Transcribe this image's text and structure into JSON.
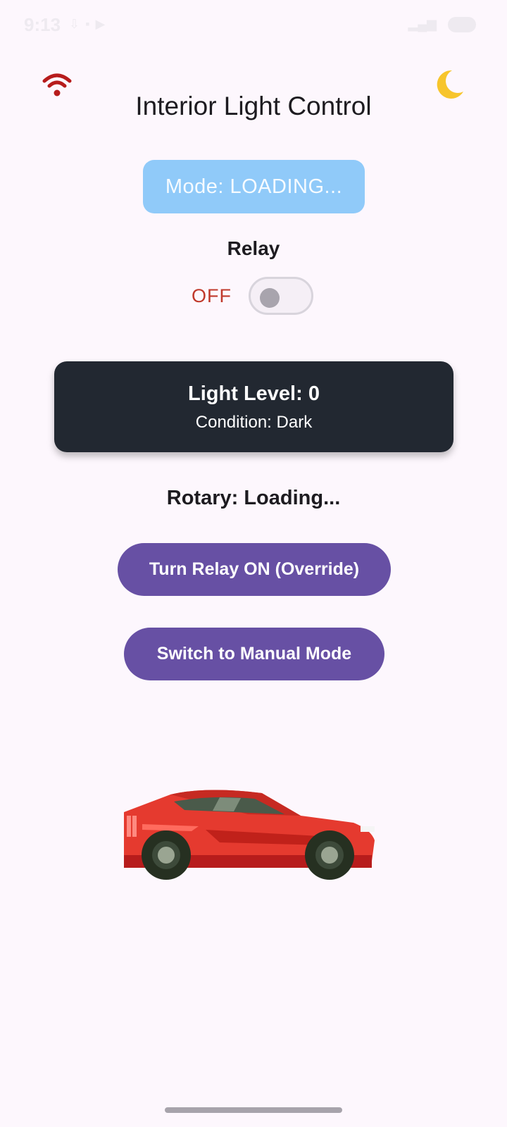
{
  "status_bar": {
    "time": "9:13",
    "battery": "■"
  },
  "header": {
    "title": "Interior Light Control",
    "wifi_icon": "wifi-icon",
    "theme_icon": "moon-icon"
  },
  "mode": {
    "label": "Mode: LOADING..."
  },
  "relay": {
    "label": "Relay",
    "state": "OFF",
    "switch_on": false
  },
  "light_card": {
    "level": "Light Level: 0",
    "condition": "Condition: Dark"
  },
  "rotary": {
    "label": "Rotary: Loading..."
  },
  "actions": {
    "relay_button": "Turn Relay ON (Override)",
    "mode_button": "Switch to Manual Mode"
  },
  "colors": {
    "background": "#fdf7fd",
    "mode_pill": "#90caf9",
    "relay_off": "#c0392b",
    "card": "#222831",
    "button": "#6750a4",
    "car_body": "#e53a2f"
  }
}
